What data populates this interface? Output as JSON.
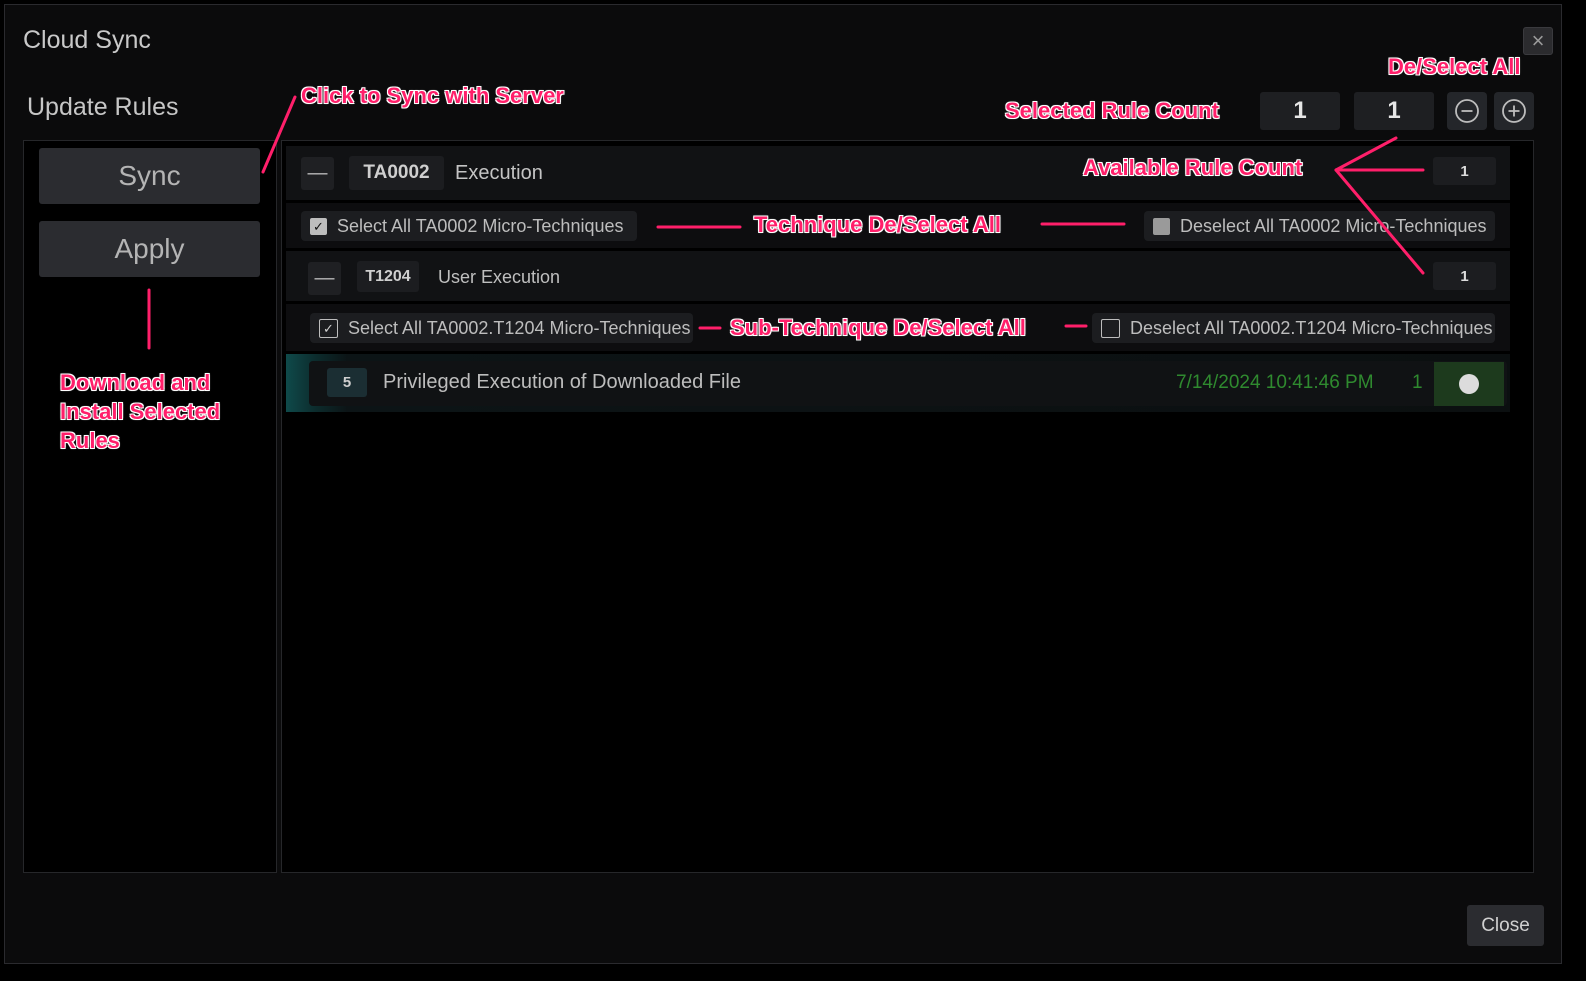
{
  "window": {
    "title": "Cloud Sync",
    "close_icon": "×"
  },
  "header": {
    "subtitle": "Update Rules",
    "selected_count": "1",
    "available_count": "1"
  },
  "sidebar": {
    "sync_label": "Sync",
    "apply_label": "Apply"
  },
  "technique": {
    "collapse_symbol": "—",
    "code": "TA0002",
    "name": "Execution",
    "count": "1",
    "select_all": "Select All TA0002 Micro-Techniques",
    "deselect_all": "Deselect All TA0002 Micro-Techniques"
  },
  "subtechnique": {
    "collapse_symbol": "—",
    "code": "T1204",
    "name": "User Execution",
    "count": "1",
    "select_all": "Select All TA0002.T1204 Micro-Techniques",
    "deselect_all": "Deselect All TA0002.T1204 Micro-Techniques"
  },
  "rule": {
    "level": "5",
    "name": "Privileged Execution of Downloaded File",
    "timestamp": "7/14/2024 10:41:46 PM",
    "count": "1"
  },
  "footer": {
    "close_label": "Close"
  },
  "annotations": {
    "sync_with_server": "Click to Sync with Server",
    "deselect_all": "De/Select All",
    "selected_rule_count": "Selected Rule Count",
    "available_rule_count": "Available Rule Count",
    "technique_deselect": "Technique De/Select All",
    "subtechnique_deselect": "Sub-Technique De/Select All",
    "download_install": [
      "Download and",
      "Install Selected",
      "Rules"
    ]
  },
  "colors": {
    "annotation": "#ff1f6a",
    "timestamp": "#2f8a2f",
    "rule_row_accent": "#0f4a4a",
    "toggle_bg": "#1d3a1d"
  }
}
